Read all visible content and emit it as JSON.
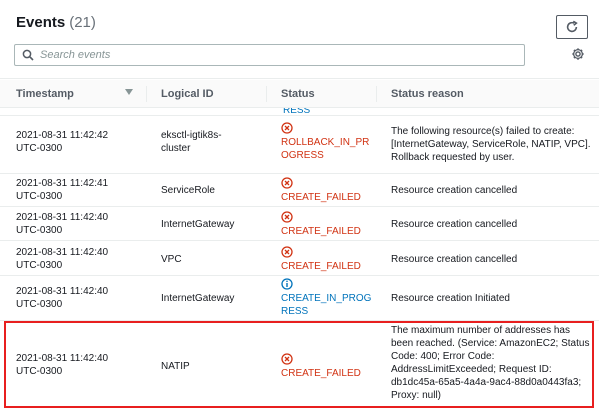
{
  "header": {
    "title": "Events",
    "count": "(21)"
  },
  "toolbar": {
    "refresh_icon": "refresh-icon",
    "settings_icon": "gear-icon"
  },
  "search": {
    "placeholder": "Search events",
    "value": ""
  },
  "table": {
    "columns": {
      "timestamp": "Timestamp",
      "logical_id": "Logical ID",
      "status": "Status",
      "status_reason": "Status reason"
    },
    "partial_top_row": {
      "status_fragment": "RESS"
    },
    "rows": [
      {
        "timestamp_line1": "2021-08-31 11:42:42",
        "timestamp_line2": "UTC-0300",
        "logical_id_line1": "eksctl-igtik8s-",
        "logical_id_line2": "cluster",
        "status_line1": "ROLLBACK_IN_PR",
        "status_line2": "OGRESS",
        "status_kind": "failed",
        "reason_lines": [
          "The following resource(s) failed to create:",
          "[InternetGateway, ServiceRole, NATIP, VPC].",
          "Rollback requested by user."
        ]
      },
      {
        "timestamp_line1": "2021-08-31 11:42:41",
        "timestamp_line2": "UTC-0300",
        "logical_id_line1": "ServiceRole",
        "logical_id_line2": "",
        "status_line1": "CREATE_FAILED",
        "status_line2": "",
        "status_kind": "failed",
        "reason_lines": [
          "Resource creation cancelled"
        ]
      },
      {
        "timestamp_line1": "2021-08-31 11:42:40",
        "timestamp_line2": "UTC-0300",
        "logical_id_line1": "InternetGateway",
        "logical_id_line2": "",
        "status_line1": "CREATE_FAILED",
        "status_line2": "",
        "status_kind": "failed",
        "reason_lines": [
          "Resource creation cancelled"
        ]
      },
      {
        "timestamp_line1": "2021-08-31 11:42:40",
        "timestamp_line2": "UTC-0300",
        "logical_id_line1": "VPC",
        "logical_id_line2": "",
        "status_line1": "CREATE_FAILED",
        "status_line2": "",
        "status_kind": "failed",
        "reason_lines": [
          "Resource creation cancelled"
        ]
      },
      {
        "timestamp_line1": "2021-08-31 11:42:40",
        "timestamp_line2": "UTC-0300",
        "logical_id_line1": "InternetGateway",
        "logical_id_line2": "",
        "status_line1": "CREATE_IN_PROG",
        "status_line2": "RESS",
        "status_kind": "progress",
        "reason_lines": [
          "Resource creation Initiated"
        ]
      },
      {
        "timestamp_line1": "2021-08-31 11:42:40",
        "timestamp_line2": "UTC-0300",
        "logical_id_line1": "NATIP",
        "logical_id_line2": "",
        "status_line1": "CREATE_FAILED",
        "status_line2": "",
        "status_kind": "failed",
        "reason_lines": [
          "The maximum number of addresses has",
          "been reached. (Service: AmazonEC2; Status",
          "Code: 400; Error Code:",
          "AddressLimitExceeded; Request ID:",
          "db1dc45a-65a5-4a4a-9ac4-88d0a0443fa3;",
          "Proxy: null)"
        ]
      }
    ]
  },
  "colors": {
    "failed": "#d13212",
    "progress": "#0073bb",
    "highlight": "#e81f1f"
  }
}
